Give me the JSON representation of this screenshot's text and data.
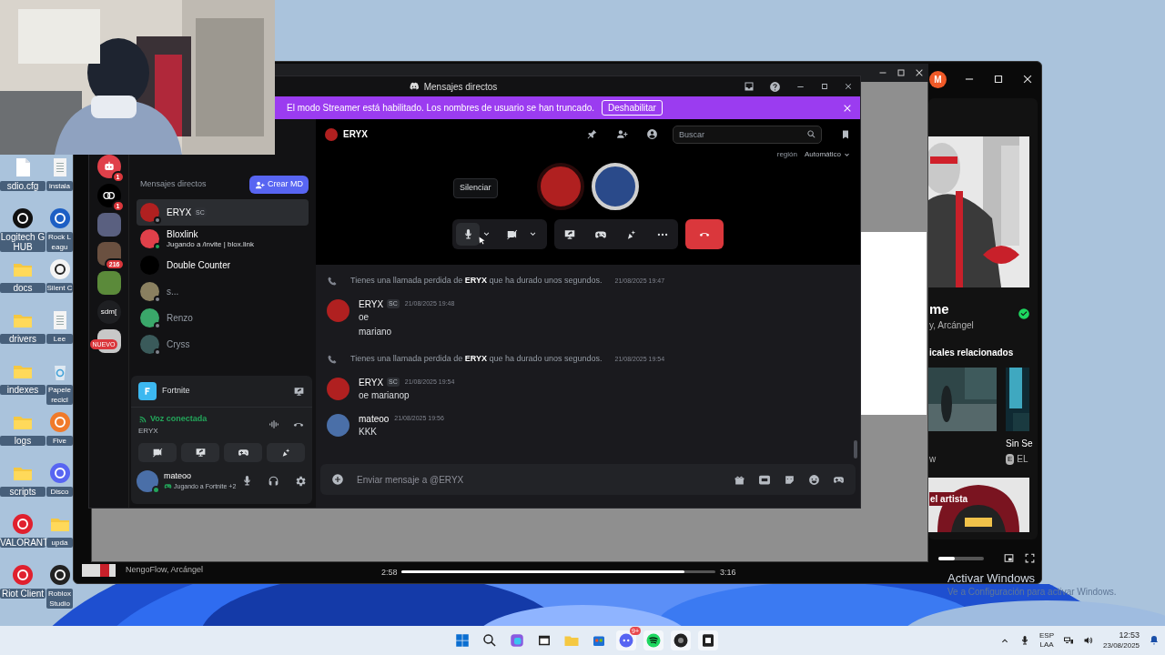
{
  "desktop_icon_columns": [
    [
      {
        "label": "sdio.cfg",
        "kind": "file"
      },
      {
        "label": "Logitech G HUB",
        "kind": "app",
        "color": "#111111"
      },
      {
        "label": "docs",
        "kind": "folder"
      },
      {
        "label": "drivers",
        "kind": "folder"
      },
      {
        "label": "indexes",
        "kind": "folder"
      },
      {
        "label": "logs",
        "kind": "folder"
      },
      {
        "label": "scripts",
        "kind": "folder"
      },
      {
        "label": "VALORANT",
        "kind": "app",
        "color": "#e0202e"
      },
      {
        "label": "Riot Client",
        "kind": "app",
        "color": "#e0202e"
      }
    ],
    [
      {
        "label": "instala",
        "kind": "doc"
      },
      {
        "label": "Rock Leagu",
        "kind": "app",
        "color": "#1d5fc4"
      },
      {
        "label": "Silent C",
        "kind": "app",
        "color": "#f4f4f4"
      },
      {
        "label": "Lee",
        "kind": "doc"
      },
      {
        "label": "Papele recicl",
        "kind": "recycle"
      },
      {
        "label": "Five",
        "kind": "app",
        "color": "#f07a2a"
      },
      {
        "label": "Disco",
        "kind": "app",
        "color": "#5865f2"
      },
      {
        "label": "upda",
        "kind": "folder"
      },
      {
        "label": "Roblox Studio",
        "kind": "app",
        "color": "#222222"
      }
    ]
  ],
  "media_window": {
    "avatar": "M",
    "track_title": "me",
    "track_artists": "y, Arcángel",
    "section_title": "icales relacionados",
    "videos": [
      {
        "subtitle": "w"
      },
      {
        "title": "Sin Se",
        "badge": "E",
        "subtitle": "EL"
      }
    ],
    "artist_card": "el artista",
    "now_playing": "NengoFlow, Arcángel",
    "elapsed": "2:58",
    "total": "3:16",
    "progress": {
      "level": 0.9
    },
    "volume": {
      "level": 0.35
    }
  },
  "activation": {
    "title": "Activar Windows",
    "subtitle": "Ve a Configuración para activar Windows."
  },
  "discord": {
    "title": "Mensajes directos",
    "banner": {
      "text": "El modo Streamer está habilitado. Los nombres de usuario se han truncado.",
      "button": "Deshabilitar"
    },
    "servers": [
      {
        "kind": "bot",
        "badge": "1"
      },
      {
        "kind": "logo",
        "badge": "1"
      },
      {
        "kind": "picture",
        "color": "#5a6080"
      },
      {
        "kind": "picture",
        "color": "#6a5040",
        "badge": "216"
      },
      {
        "kind": "picture",
        "color": "#5b8a3a"
      },
      {
        "kind": "text",
        "text": "sdm["
      },
      {
        "kind": "picture",
        "color": "#c8c8c8",
        "badge_new": "NUEVO"
      }
    ],
    "dm_heading": "Mensajes directos",
    "create_dm": "Crear MD",
    "dms": [
      {
        "name": "ERYX",
        "tag": "SC",
        "color": "#b02020",
        "online": false,
        "selected": true
      },
      {
        "name": "Bloxlink",
        "activity": "Jugando a /invite | blox.link",
        "color": "#e0404a",
        "online": true,
        "selected": false
      },
      {
        "name": "Double Counter",
        "color": "#000000",
        "selected": false
      },
      {
        "name": "s...",
        "color": "#8a8060",
        "online": false,
        "selected": false
      },
      {
        "name": "Renzo",
        "color": "#3aa86a",
        "online": false,
        "selected": false
      },
      {
        "name": "Cryss",
        "color": "#3a5a5a",
        "online": false,
        "selected": false
      }
    ],
    "activity": {
      "game": "Fortnite",
      "voice_status": "Voz conectada",
      "voice_channel": "ERYX"
    },
    "user": {
      "name": "mateoo",
      "status": "Jugando a Fortnite +2"
    },
    "channel": {
      "name": "ERYX",
      "search_placeholder": "Buscar",
      "region_label": "región",
      "region_value": "Automático",
      "tooltip": "Silenciar"
    },
    "messages": [
      {
        "kind": "call",
        "text": "Tienes una llamada perdida de **ERYX** que ha durado unos segundos.",
        "time": "21/08/2025 19:47"
      },
      {
        "kind": "message",
        "author": "ERYX",
        "tag": "SC",
        "color": "#b02020",
        "time": "21/08/2025 19:48",
        "lines": [
          "oe",
          "mariano"
        ]
      },
      {
        "kind": "call",
        "text": "Tienes una llamada perdida de **ERYX** que ha durado unos segundos.",
        "time": "21/08/2025 19:54"
      },
      {
        "kind": "message",
        "author": "ERYX",
        "tag": "SC",
        "color": "#b02020",
        "time": "21/08/2025 19:54",
        "lines": [
          "oe marianop"
        ]
      },
      {
        "kind": "message",
        "author": "mateoo",
        "color": "#4a6fa8",
        "time": "21/08/2025 19:56",
        "lines": [
          "KKK"
        ]
      }
    ],
    "composer_placeholder": "Enviar mensaje a @ERYX"
  },
  "taskbar": {
    "discord_badge": "9+",
    "language": "ESP",
    "layout": "LAA",
    "time": "12:53",
    "date": "23/08/2025"
  }
}
